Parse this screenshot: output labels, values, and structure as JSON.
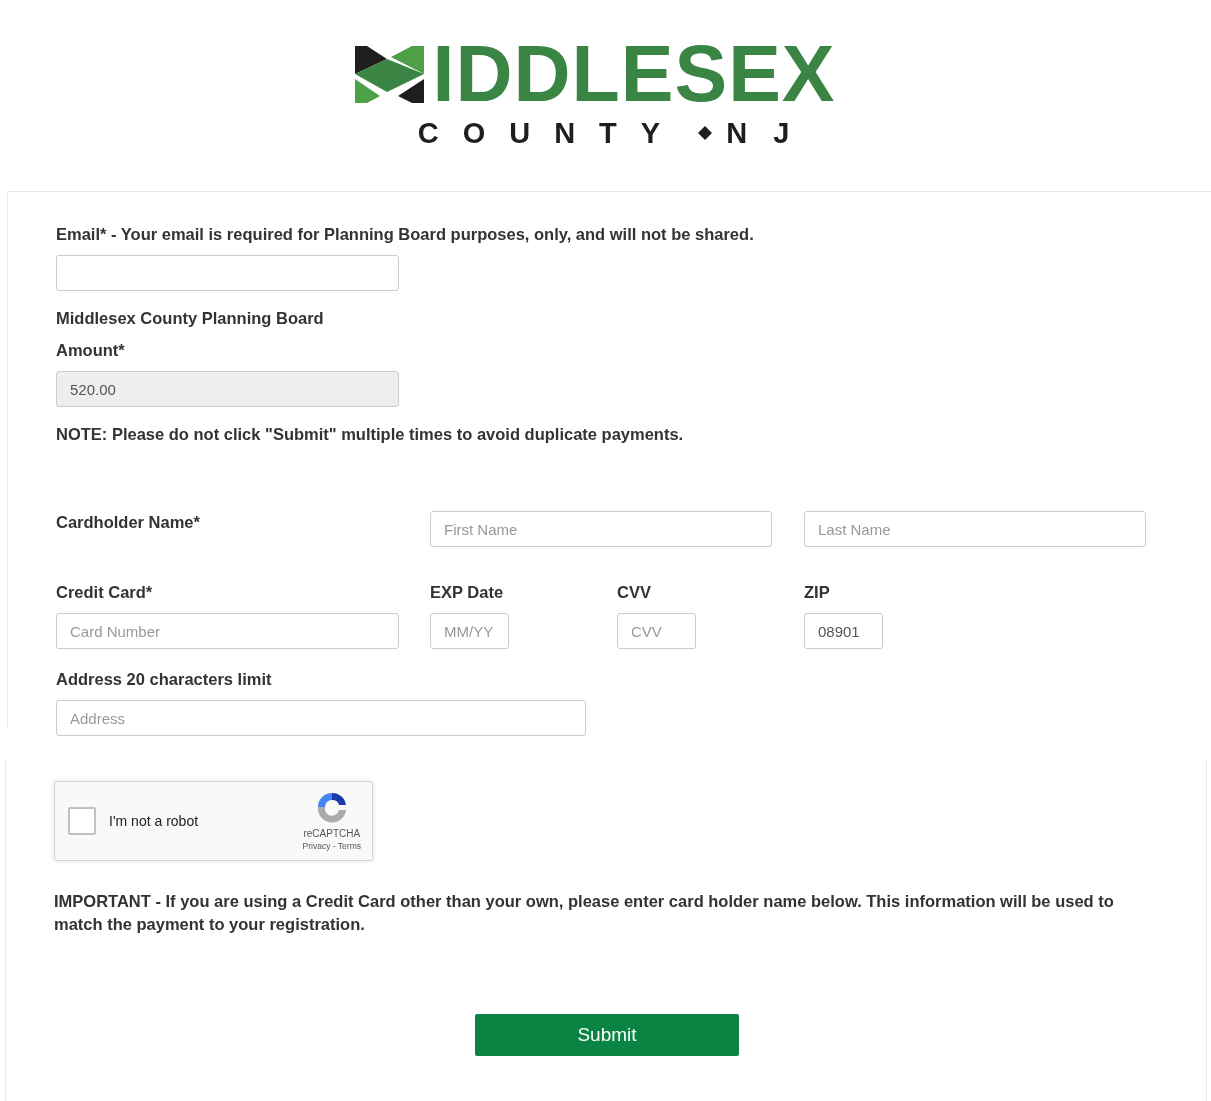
{
  "logo": {
    "wordmark": "IDDLESEX",
    "county": "COUNTY",
    "state": "NJ"
  },
  "email": {
    "label": "Email* - Your email is required for Planning Board purposes, only, and will not be shared."
  },
  "amount": {
    "label_1": "Middlesex County Planning Board",
    "label_2": "Amount*",
    "value": "520.00",
    "disabled": true
  },
  "note": "NOTE: Please do not click \"Submit\" multiple times to avoid duplicate payments.",
  "cardholder": {
    "label": "Cardholder Name*",
    "first_placeholder": "First Name",
    "last_placeholder": "Last Name"
  },
  "card_fields": [
    {
      "label": "Credit Card*",
      "placeholder": "Card Number"
    },
    {
      "label": "EXP Date",
      "placeholder": "MM/YY"
    },
    {
      "label": "CVV",
      "placeholder": "CVV"
    },
    {
      "label": "ZIP",
      "value": "08901"
    }
  ],
  "address": {
    "label": "Address 20 characters limit",
    "placeholder": "Address"
  },
  "captcha": {
    "label": "I'm not a robot",
    "checked": false,
    "brand": "reCAPTCHA",
    "footer": "Privacy - Terms"
  },
  "important": "IMPORTANT - If you are using a Credit Card other than your own, please enter card holder name below. This information will be used to match the payment to your registration.",
  "submit": "Submit"
}
